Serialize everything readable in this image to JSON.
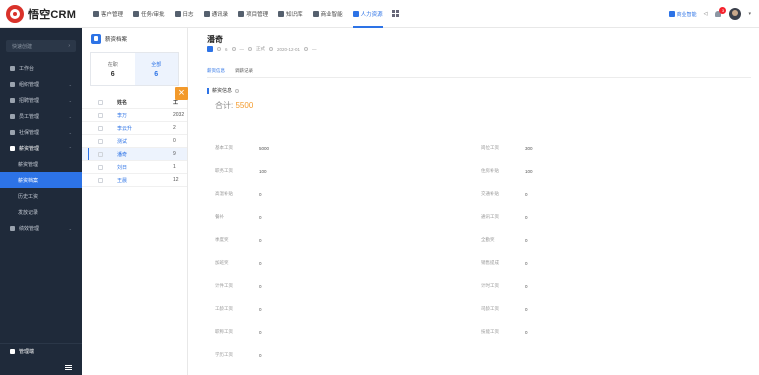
{
  "app": {
    "logo_text": "悟空CRM"
  },
  "nav": [
    {
      "label": "客户管理",
      "icon": "customer-icon",
      "active": false
    },
    {
      "label": "任务/审批",
      "icon": "task-icon",
      "active": false
    },
    {
      "label": "日志",
      "icon": "log-icon",
      "active": false
    },
    {
      "label": "通讯录",
      "icon": "contacts-icon",
      "active": false
    },
    {
      "label": "项目管理",
      "icon": "project-icon",
      "active": false
    },
    {
      "label": "知识库",
      "icon": "knowledge-icon",
      "active": false
    },
    {
      "label": "商业智能",
      "icon": "bi-icon",
      "active": false
    },
    {
      "label": "人力资源",
      "icon": "hr-icon",
      "active": true
    }
  ],
  "topright": {
    "upgrade_label": "商业智能",
    "notify_count": "3"
  },
  "sidebar": {
    "quick_label": "快速创建",
    "items": [
      {
        "label": "工作台",
        "icon": "dashboard-icon"
      },
      {
        "label": "组织管理",
        "icon": "org-icon"
      },
      {
        "label": "招聘管理",
        "icon": "recruit-icon"
      },
      {
        "label": "员工管理",
        "icon": "employee-icon"
      },
      {
        "label": "社保管理",
        "icon": "insurance-icon"
      },
      {
        "label": "薪资管理",
        "icon": "salary-icon"
      }
    ],
    "salary_subitems": [
      "薪资管理",
      "薪资档案",
      "历史工资",
      "发放记录"
    ],
    "active_sub": "薪资档案",
    "after_items": [
      {
        "label": "绩效管理",
        "icon": "performance-icon"
      }
    ],
    "admin_label": "管理端"
  },
  "list": {
    "title": "薪资档案",
    "stats": [
      {
        "label": "在职",
        "value": "6"
      },
      {
        "label": "全部",
        "value": "6"
      }
    ],
    "columns": {
      "name": "姓名",
      "value": "工"
    },
    "rows": [
      {
        "name": "李万",
        "value": "2032"
      },
      {
        "name": "李云升",
        "value": "2"
      },
      {
        "name": "测试",
        "value": "0"
      },
      {
        "name": "潘奇",
        "value": "9"
      },
      {
        "name": "刘日",
        "value": "1"
      },
      {
        "name": "王晨",
        "value": "12"
      }
    ],
    "selected_index": 3
  },
  "detail": {
    "name": "潘奇",
    "meta": [
      "6",
      "—",
      "正式",
      "2020-12-01",
      "—"
    ],
    "tabs": [
      "薪资信息",
      "调薪记录"
    ],
    "section_title": "薪资信息",
    "total_label": "合计:",
    "total_value": "5500",
    "left_fields": [
      {
        "label": "基本工资",
        "value": "5000"
      },
      {
        "label": "职务工资",
        "value": "100"
      },
      {
        "label": "高温补贴",
        "value": "0"
      },
      {
        "label": "餐补",
        "value": "0"
      },
      {
        "label": "季度奖",
        "value": "0"
      },
      {
        "label": "加班奖",
        "value": "0"
      },
      {
        "label": "计件工资",
        "value": "0"
      },
      {
        "label": "工龄工资",
        "value": "0"
      },
      {
        "label": "职称工资",
        "value": "0"
      },
      {
        "label": "学历工资",
        "value": "0"
      }
    ],
    "right_fields": [
      {
        "label": "岗位工资",
        "value": "300"
      },
      {
        "label": "住房补贴",
        "value": "100"
      },
      {
        "label": "交通补贴",
        "value": "0"
      },
      {
        "label": "通讯工资",
        "value": "0"
      },
      {
        "label": "全勤奖",
        "value": "0"
      },
      {
        "label": "销售提成",
        "value": "0"
      },
      {
        "label": "计时工资",
        "value": "0"
      },
      {
        "label": "司龄工资",
        "value": "0"
      },
      {
        "label": "技能工资",
        "value": "0"
      }
    ]
  }
}
